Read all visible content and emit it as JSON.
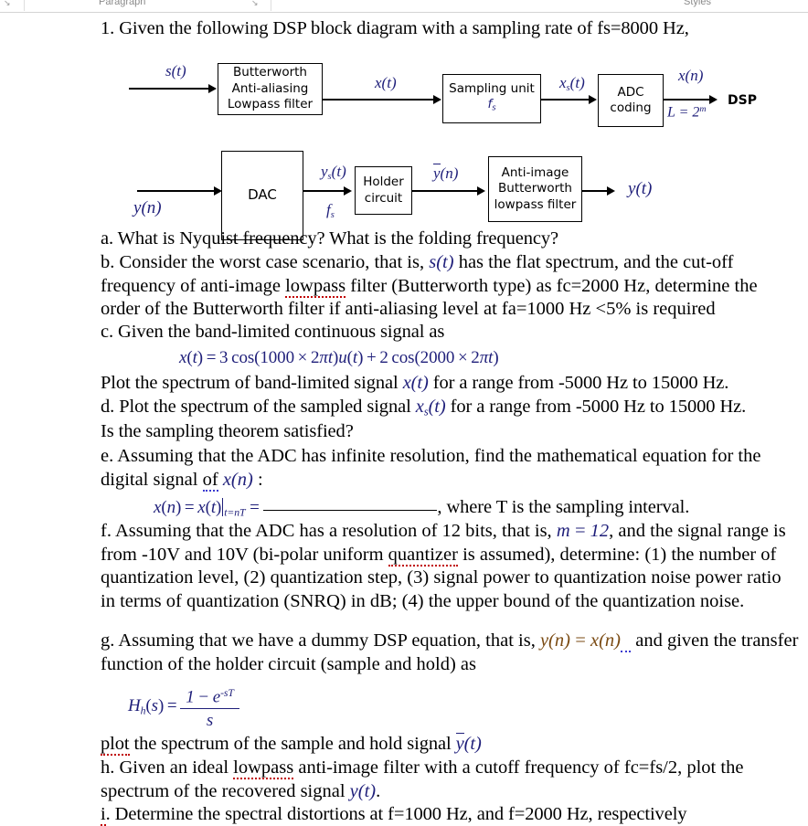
{
  "ribbon": {
    "group_paragraph": "Paragraph",
    "group_styles": "Styles",
    "launcher_glyph": "↘"
  },
  "document": {
    "heading": "1. Given the following DSP block diagram with a sampling rate of fs=8000 Hz,",
    "diagram_top": {
      "input_label": "s(t)",
      "blocks": [
        {
          "line1": "Butterworth",
          "line2": "Anti-aliasing",
          "line3": "Lowpass filter"
        },
        {
          "line1": "Sampling unit",
          "line2": "fs"
        },
        {
          "line1": "ADC",
          "line2": "coding"
        }
      ],
      "signal_xt": "x(t)",
      "signal_xst": "xs(t)",
      "signal_xn": "x(n)",
      "levels_label": "L = 2^m",
      "output_label": "DSP"
    },
    "diagram_bottom": {
      "input_label": "y(n)",
      "blocks": [
        {
          "line1": "DAC"
        },
        {
          "line1": "Holder",
          "line2": "circuit"
        },
        {
          "line1": "Anti-image",
          "line2": "Butterworth",
          "line3": "lowpass filter"
        }
      ],
      "signal_yst": "ys(t)",
      "signal_fs": "fs",
      "signal_ybarn": "y(n)",
      "output_label": "y(t)"
    },
    "items": {
      "a": "a. What is Nyquist frequency?  What is the folding frequency?",
      "b_part1": "b. Consider the worst case scenario, that is, ",
      "b_var": "s(t)",
      "b_part2": " has the flat spectrum, and the cut-off frequency of anti-image ",
      "b_misspelled": "lowpass",
      "b_part3": " filter (Butterworth type) as fc=2000 Hz, determine the order of the Butterworth filter if anti-aliasing level at fa=1000 Hz <5% is required",
      "c_lead": "c. Given the band-limited continuous signal as",
      "c_equation": "x(t) = 3cos(1000×2πt)u(t) + 2cos(2000×2πt)",
      "c_follow_part1": "Plot the spectrum of band-limited signal ",
      "c_follow_var": "x(t)",
      "c_follow_part2": " for a range from -5000 Hz to 15000 Hz.",
      "d_part1": "d. Plot the spectrum of the sampled signal ",
      "d_var": "xs(t)",
      "d_part2": " for a range from -5000 Hz to 15000 Hz.",
      "d_line2": "Is the sampling theorem satisfied?",
      "e_part1": "e. Assuming that the ADC has infinite resolution, find the mathematical equation for the digital signal ",
      "e_misspelled": "of",
      "e_part2": " ",
      "e_var": "x(n)",
      "e_part3": " :",
      "e_equation_lhs": "x(n) = x(t)",
      "e_equation_eval": "t=nT",
      "e_equation_eq": " = ",
      "e_equation_tail": ", where T is the sampling interval.",
      "f_part1": "f. Assuming that the ADC has a resolution of 12 bits, that is, ",
      "f_var": "m = 12",
      "f_part2": ", and the signal range is from -10V and 10V (bi-polar uniform ",
      "f_misspelled": "quantizer",
      "f_part3": " is assumed), determine: (1) the number of quantization level, (2) quantization step, (3) signal power to quantization noise power ratio in terms of quantization (SNRQ) in dB; (4) the upper bound of the quantization noise.",
      "g_part1": "g. Assuming that we have a dummy DSP equation, that is, ",
      "g_var": "y(n) = x(n)",
      "g_part2": " and given the transfer function of the holder circuit (sample and hold) as",
      "g_equation_lhs": "Hh(s) =",
      "g_equation_num": "1 − e",
      "g_equation_num_sup": "-sT",
      "g_equation_den": "s",
      "g_follow_misspelled": "plot",
      "g_follow_part1": " the spectrum of the sample and hold signal ",
      "g_follow_var": "y(t)",
      "h_part1": "h. Given an ideal ",
      "h_misspelled": "lowpass",
      "h_part2": " anti-image filter with a cutoff frequency of fc=fs/2, plot the spectrum of the recovered signal ",
      "h_var": "y(t)",
      "h_part3": ".",
      "i_misspelled": "i",
      "i_part1": ". Determine the spectral distortions at f=1000 Hz, and f=2000 Hz, respectively"
    }
  },
  "colors": {
    "math_navy": "#1f1f7a",
    "math_brown": "#7a4a12",
    "spell_red": "#c00000",
    "spell_blue": "#3a3ad0",
    "page_bg": "#ffffff",
    "ribbon_text": "#8a8a8a"
  }
}
